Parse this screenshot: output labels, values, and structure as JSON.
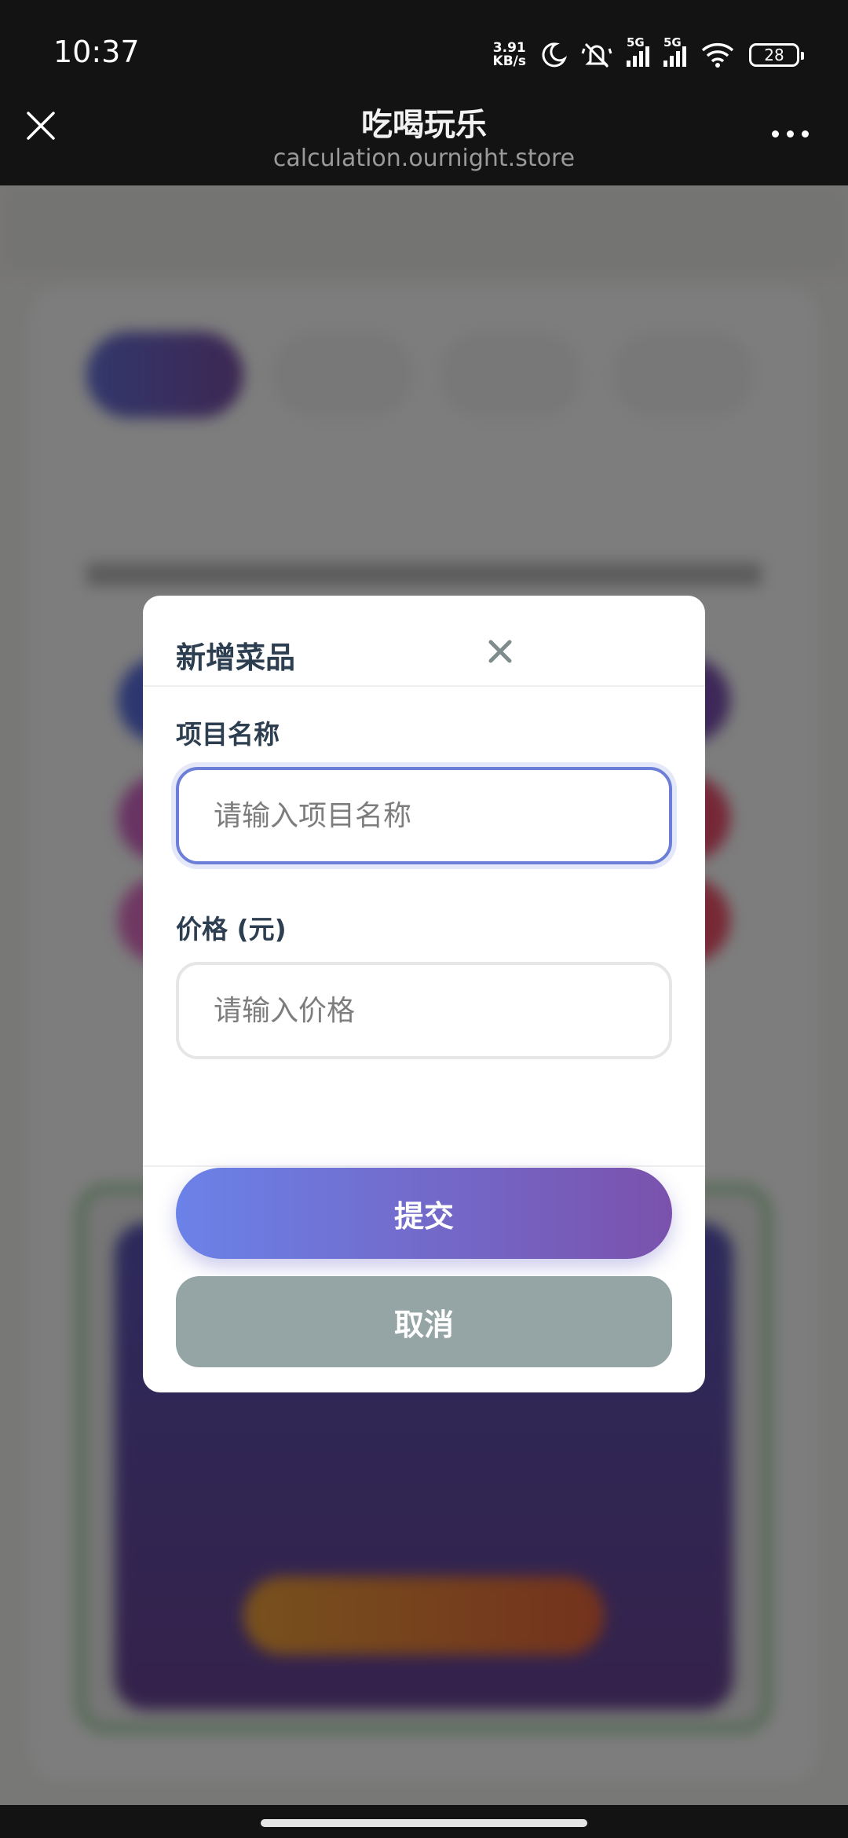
{
  "status_bar": {
    "time": "10:37",
    "net_speed_value": "3.91",
    "net_speed_unit": "KB/s",
    "signal_tag_1": "5G",
    "signal_tag_2": "5G",
    "battery": "28",
    "icons": [
      "moon-icon",
      "mute-icon",
      "signal-icon",
      "signal-icon",
      "wifi-icon",
      "battery-icon"
    ]
  },
  "browser": {
    "title": "吃喝玩乐",
    "url": "calculation.ournight.store",
    "close_icon": "close-icon",
    "menu_icon": "more-icon"
  },
  "modal": {
    "title": "新增菜品",
    "close_icon": "close-icon",
    "name_label": "项目名称",
    "name_placeholder": "请输入项目名称",
    "name_value": "",
    "price_label": "价格 (元)",
    "price_placeholder": "请输入价格",
    "price_value": "",
    "submit_label": "提交",
    "cancel_label": "取消"
  },
  "colors": {
    "accent_start": "#6b82e8",
    "accent_end": "#7a52ad",
    "cancel": "#95a5a6",
    "title_text": "#2c3e50",
    "focus_border": "#6c7fd8"
  }
}
